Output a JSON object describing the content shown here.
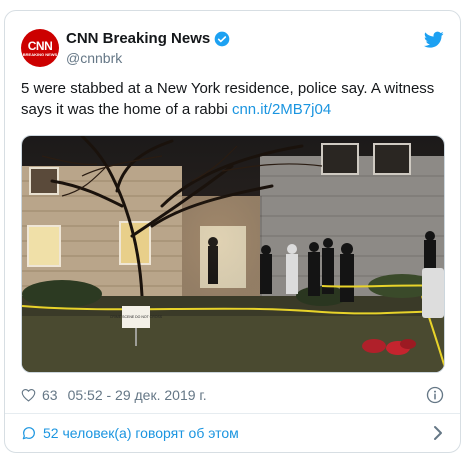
{
  "tweet": {
    "author_name": "CNN Breaking News",
    "author_handle": "@cnnbrk",
    "avatar_logo": "CNN",
    "avatar_sub": "BREAKING NEWS",
    "text_body": "5 were stabbed at a New York residence, police say. A witness says it was the home of a rabbi ",
    "link_text": "cnn.it/2MB7j04",
    "sign_text": "CRIME SCENE DO NOT CROSS",
    "likes": "63",
    "timestamp": "05:52 - 29 дек. 2019 г.",
    "replies_label": "52 человек(а) говорят об этом"
  },
  "colors": {
    "brand_red": "#cc0000",
    "twitter_blue": "#1da1f2",
    "link_blue": "#1b95e0",
    "text": "#14171a",
    "muted": "#657786"
  },
  "icons": [
    "verified-badge-icon",
    "twitter-bird-icon",
    "heart-icon",
    "info-icon",
    "comment-bubble-icon",
    "chevron-right-icon"
  ]
}
